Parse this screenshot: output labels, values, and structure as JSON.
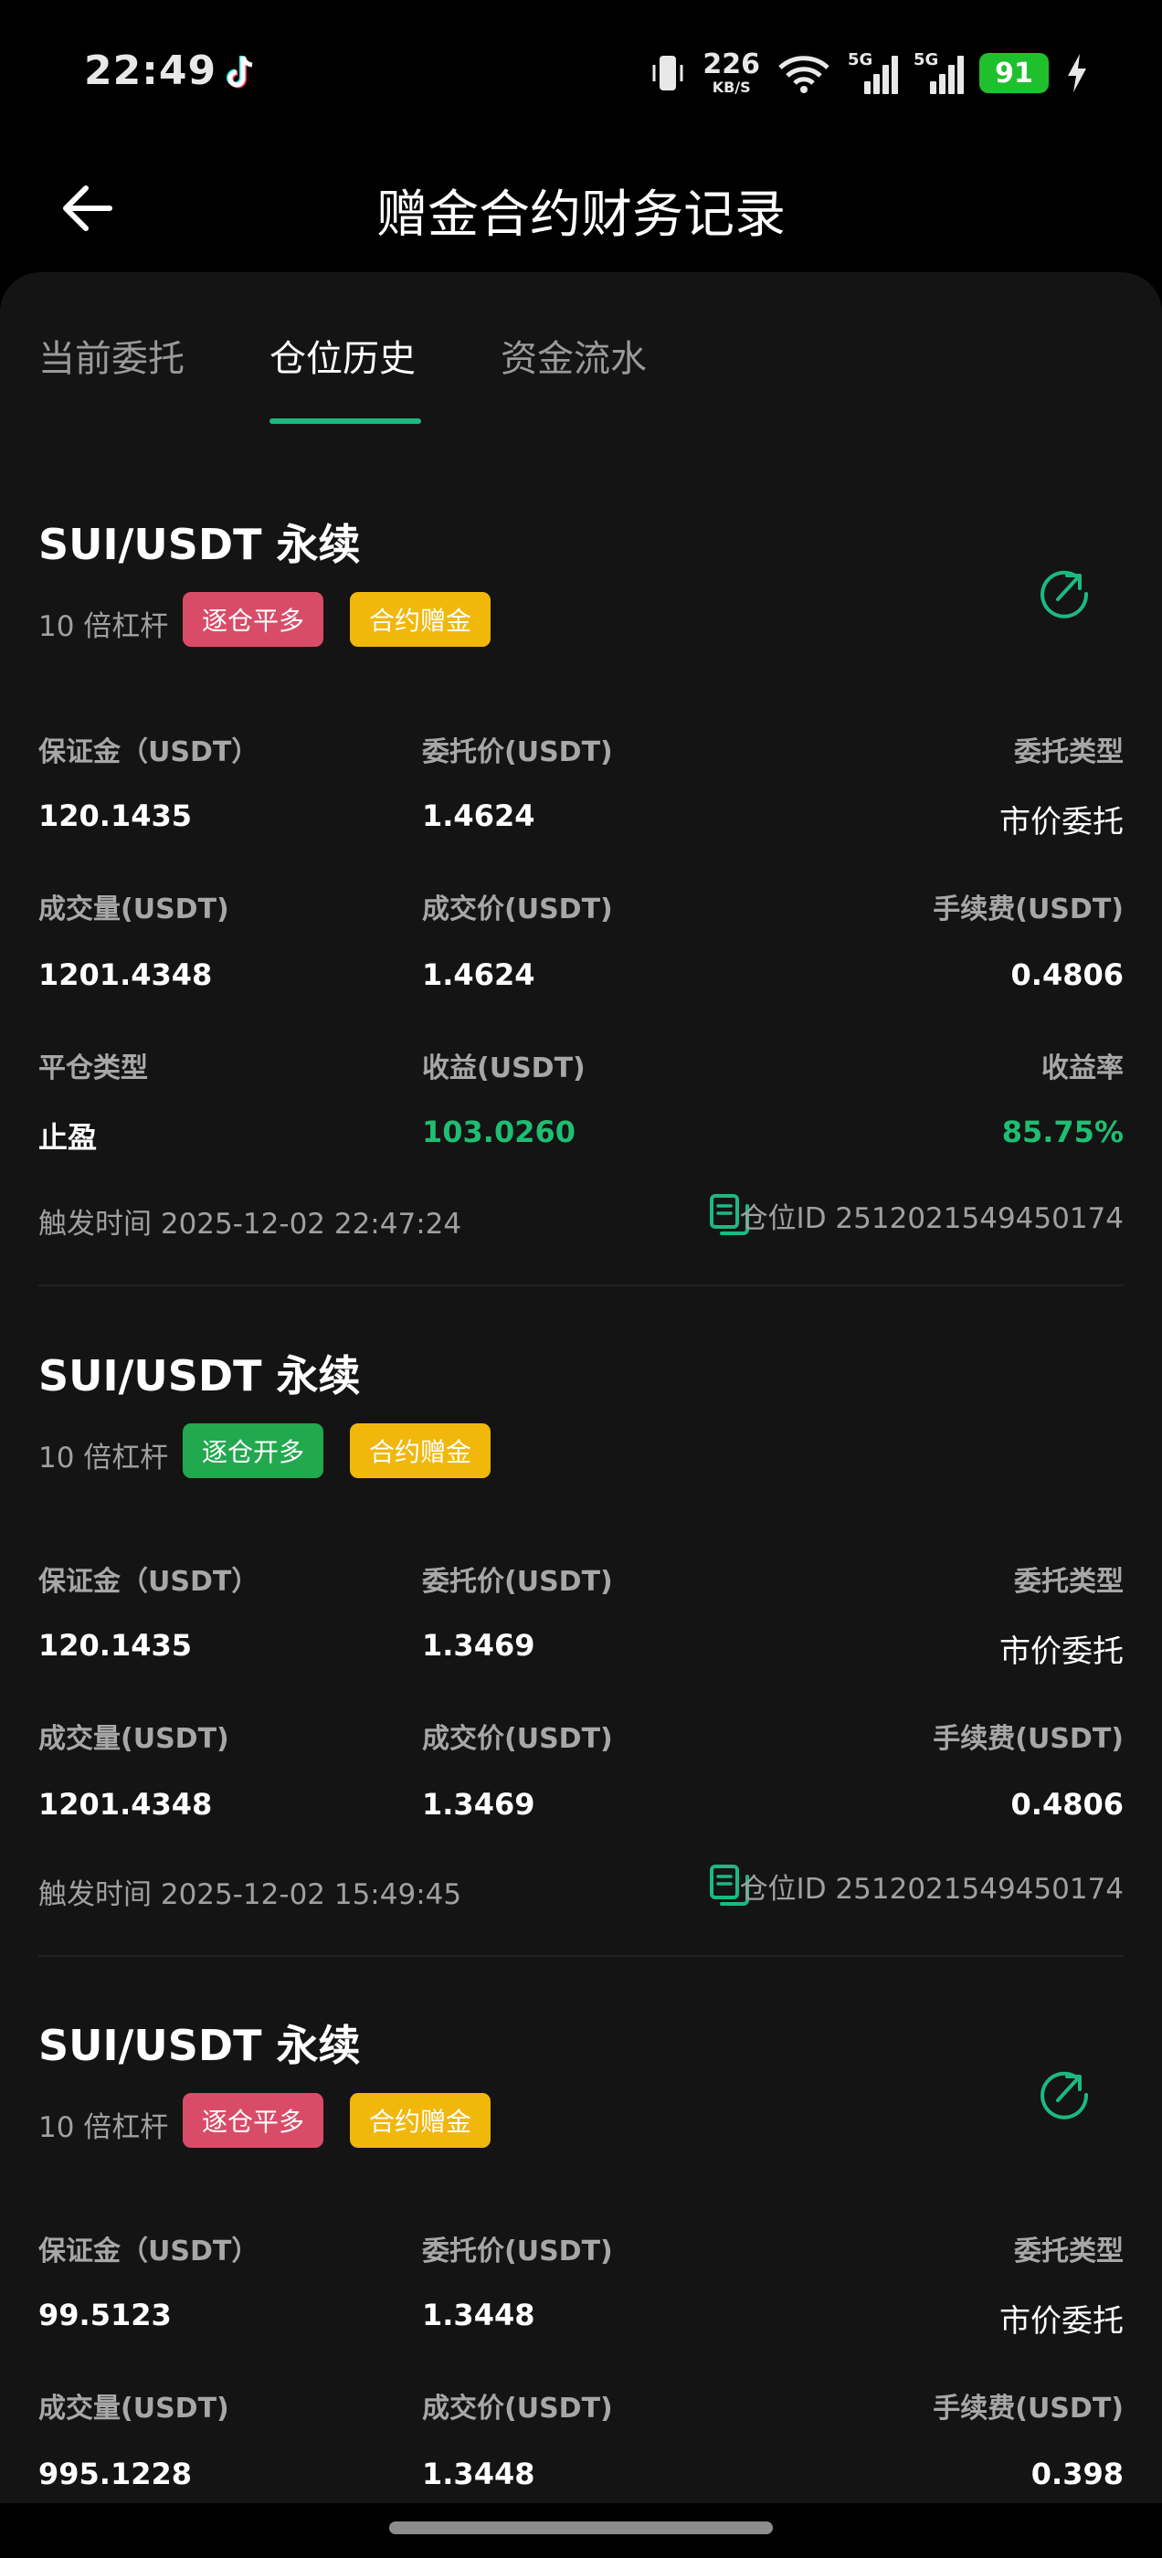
{
  "status_bar": {
    "time": "22:49",
    "speed_value": "226",
    "speed_unit": "KB/S",
    "net1": "5G",
    "net2": "5G",
    "battery": "91",
    "icons": [
      "tiktok-icon",
      "vibrate-icon",
      "wifi-icon",
      "signal-icon",
      "charging-icon"
    ]
  },
  "header": {
    "title": "赠金合约财务记录",
    "back_icon": "arrow-left-icon"
  },
  "tabs": [
    {
      "label": "当前委托",
      "active": false
    },
    {
      "label": "仓位历史",
      "active": true
    },
    {
      "label": "资金流水",
      "active": false
    }
  ],
  "accent_color": "#1db981",
  "records": [
    {
      "title": "SUI/USDT 永续",
      "leverage": "10 倍杠杆",
      "badge_side": "逐仓平多",
      "badge_side_color": "#d94c68",
      "badge_type": "合约赠金",
      "margin_label": "保证金（USDT）",
      "margin": "120.1435",
      "order_price_label": "委托价(USDT)",
      "order_price": "1.4624",
      "order_type_label": "委托类型",
      "order_type": "市价委托",
      "volume_label": "成交量(USDT)",
      "volume": "1201.4348",
      "fill_price_label": "成交价(USDT)",
      "fill_price": "1.4624",
      "fee_label": "手续费(USDT)",
      "fee": "0.4806",
      "close_type_label": "平仓类型",
      "close_type": "止盈",
      "pnl_label": "收益(USDT)",
      "pnl": "103.0260",
      "roi_label": "收益率",
      "roi": "85.75%",
      "trigger_time": "触发时间 2025-12-02 22:47:24",
      "position_id": "仓位ID 2512021549450174"
    },
    {
      "title": "SUI/USDT 永续",
      "leverage": "10 倍杠杆",
      "badge_side": "逐仓开多",
      "badge_side_color": "#22a84e",
      "badge_type": "合约赠金",
      "margin_label": "保证金（USDT）",
      "margin": "120.1435",
      "order_price_label": "委托价(USDT)",
      "order_price": "1.3469",
      "order_type_label": "委托类型",
      "order_type": "市价委托",
      "volume_label": "成交量(USDT)",
      "volume": "1201.4348",
      "fill_price_label": "成交价(USDT)",
      "fill_price": "1.3469",
      "fee_label": "手续费(USDT)",
      "fee": "0.4806",
      "trigger_time": "触发时间 2025-12-02 15:49:45",
      "position_id": "仓位ID 2512021549450174"
    },
    {
      "title": "SUI/USDT 永续",
      "leverage": "10 倍杠杆",
      "badge_side": "逐仓平多",
      "badge_side_color": "#d94c68",
      "badge_type": "合约赠金",
      "margin_label": "保证金（USDT）",
      "margin": "99.5123",
      "order_price_label": "委托价(USDT)",
      "order_price": "1.3448",
      "order_type_label": "委托类型",
      "order_type": "市价委托",
      "volume_label": "成交量(USDT)",
      "volume": "995.1228",
      "fill_price_label": "成交价(USDT)",
      "fill_price": "1.3448",
      "fee_label": "手续费(USDT)",
      "fee": "0.398"
    }
  ]
}
